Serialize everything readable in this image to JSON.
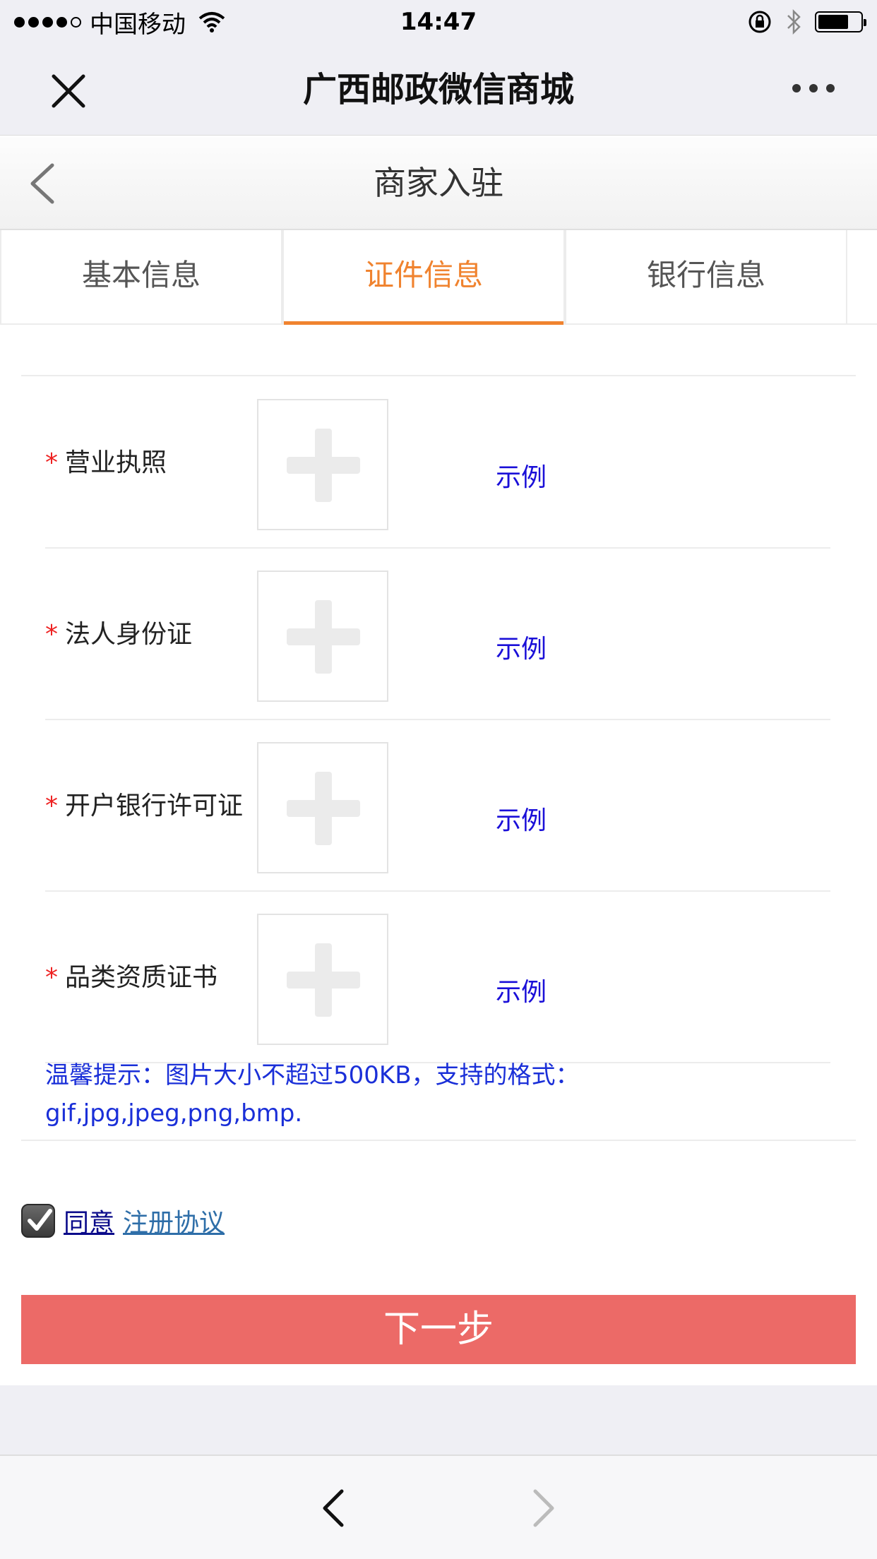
{
  "status_bar": {
    "carrier": "中国移动",
    "time": "14:47"
  },
  "wechat_nav": {
    "title": "广西邮政微信商城"
  },
  "page_header": {
    "title": "商家入驻"
  },
  "tabs": [
    {
      "label": "基本信息",
      "active": false
    },
    {
      "label": "证件信息",
      "active": true
    },
    {
      "label": "银行信息",
      "active": false
    }
  ],
  "uploads": [
    {
      "required_mark": "*",
      "label": "营业执照",
      "example": "示例"
    },
    {
      "required_mark": "*",
      "label": "法人身份证",
      "example": "示例"
    },
    {
      "required_mark": "*",
      "label": "开户银行许可证",
      "example": "示例"
    },
    {
      "required_mark": "*",
      "label": "品类资质证书",
      "example": "示例"
    }
  ],
  "tip": {
    "line1": "温馨提示：图片大小不超过500KB，支持的格式：",
    "line2": "gif,jpg,jpeg,png,bmp."
  },
  "agreement": {
    "agree_label": "同意",
    "link_label": "注册协议",
    "checked": true
  },
  "next_button": {
    "label": "下一步"
  },
  "colors": {
    "accent": "#f0832f",
    "button": "#ec6a67",
    "link": "#1a0fd8"
  }
}
